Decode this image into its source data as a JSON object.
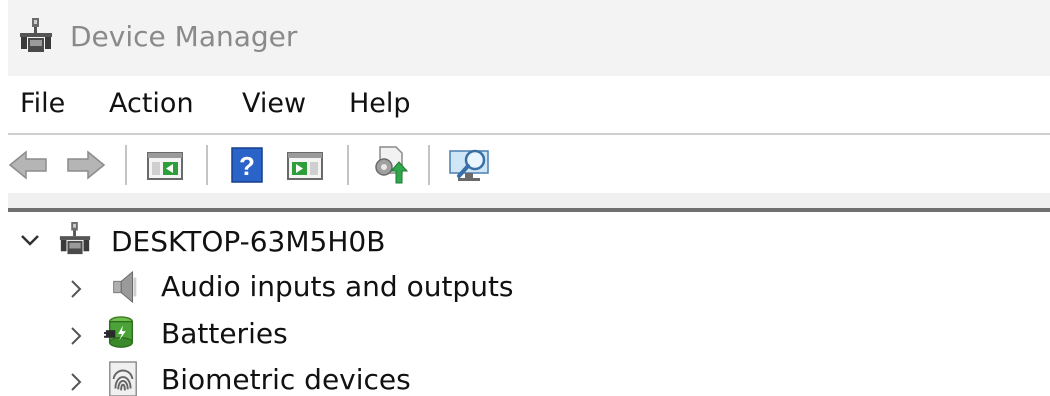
{
  "window": {
    "title": "Device Manager",
    "title_icon": "device-manager-icon"
  },
  "menu": {
    "items": [
      "File",
      "Action",
      "View",
      "Help"
    ]
  },
  "toolbar": {
    "buttons": [
      {
        "icon": "back-arrow-icon"
      },
      {
        "icon": "forward-arrow-icon"
      },
      {
        "icon": "show-hide-console-tree-icon"
      },
      {
        "icon": "help-icon"
      },
      {
        "icon": "show-hide-action-pane-icon"
      },
      {
        "icon": "update-driver-icon"
      },
      {
        "icon": "scan-hardware-changes-icon"
      }
    ]
  },
  "tree": {
    "root": {
      "label": "DESKTOP-63M5H0B",
      "expanded": true,
      "icon": "computer-icon"
    },
    "children": [
      {
        "label": "Audio inputs and outputs",
        "expanded": false,
        "icon": "speaker-icon"
      },
      {
        "label": "Batteries",
        "expanded": false,
        "icon": "battery-icon"
      },
      {
        "label": "Biometric devices",
        "expanded": false,
        "icon": "fingerprint-icon"
      }
    ]
  },
  "colors": {
    "title_text": "#8a8a8a",
    "titlebar_bg": "#f3f3f3",
    "accent_blue": "#2a64c8"
  }
}
